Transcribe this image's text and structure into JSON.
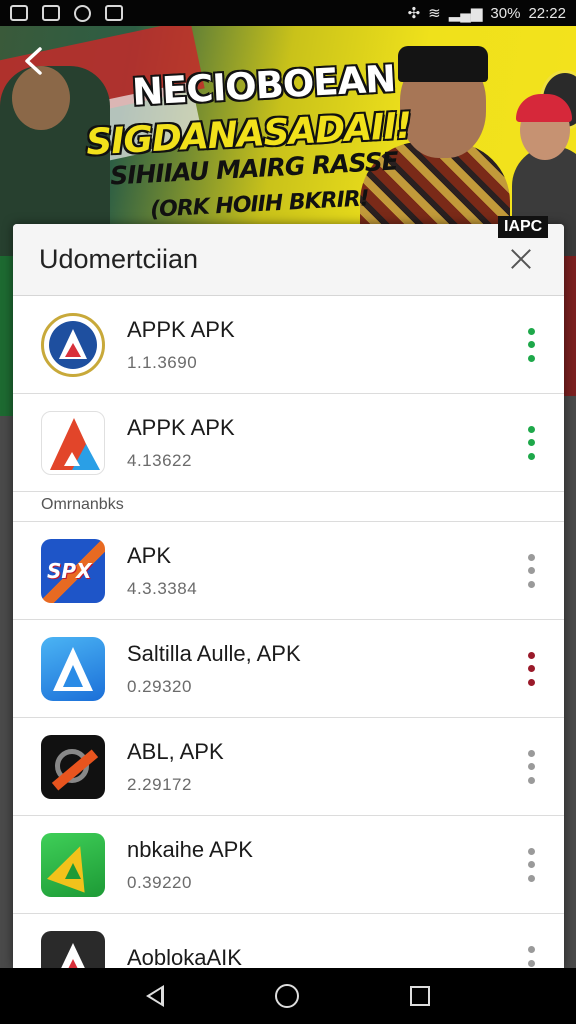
{
  "status_bar": {
    "battery": "30%",
    "time": "22:22"
  },
  "banner": {
    "line1": "NECIOBOEAN",
    "line2": "SIGDANASADAII!",
    "line3": "SIHIIAU MAIRG RASSE",
    "line4": "(ORK HOIIH BKRIR!",
    "badge": "IAPC"
  },
  "sheet": {
    "title": "Udomertciian",
    "section_label": "Omrnanbks"
  },
  "apps_top": [
    {
      "name": "APPK APK",
      "version": "1.1.3690",
      "dots_color": "#1ea84a"
    },
    {
      "name": "APPK APK",
      "version": "4.13622",
      "dots_color": "#1ea84a"
    }
  ],
  "apps_bottom": [
    {
      "name": "APK",
      "version": "4.3.3384",
      "dots_color": "#9a9a9a"
    },
    {
      "name": "Saltilla Aulle, APK",
      "version": "0.29320",
      "dots_color": "#9a1a2a"
    },
    {
      "name": "ABL, APK",
      "version": "2.29172",
      "dots_color": "#9a9a9a"
    },
    {
      "name": "nbkaihe APK",
      "version": "0.39220",
      "dots_color": "#9a9a9a"
    },
    {
      "name": "AoblokaAIK",
      "version": "",
      "dots_color": "#9a9a9a"
    }
  ],
  "icons": {
    "back": "arrow-left-icon",
    "close": "close-icon",
    "more": "more-vertical-icon"
  }
}
